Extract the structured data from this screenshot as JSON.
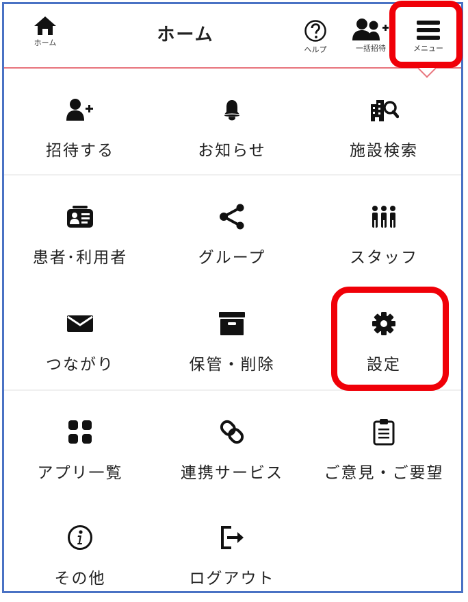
{
  "header": {
    "title": "ホーム",
    "home_label": "ホーム",
    "help_label": "ヘルプ",
    "bulk_invite_label": "一括招待",
    "menu_label": "メニュー"
  },
  "menu": {
    "invite": "招待する",
    "notifications": "お知らせ",
    "facility_search": "施設検索",
    "patients_users": "患者･利用者",
    "groups": "グループ",
    "staff": "スタッフ",
    "connections": "つながり",
    "archive_delete": "保管・削除",
    "settings": "設定",
    "app_list": "アプリ一覧",
    "integration_services": "連携サービス",
    "feedback_requests": "ご意見・ご要望",
    "other": "その他",
    "logout": "ログアウト"
  },
  "icons": {
    "home": "home-icon",
    "help": "help-circle-icon",
    "bulk_invite": "user-plus-group-icon",
    "menu": "hamburger-menu-icon",
    "invite": "user-plus-icon",
    "notifications": "bell-icon",
    "facility_search": "building-search-icon",
    "patients_users": "id-card-icon",
    "groups": "share-nodes-icon",
    "staff": "people-group-icon",
    "connections": "envelope-icon",
    "archive_delete": "archive-box-icon",
    "settings": "gear-icon",
    "app_list": "grid-icon",
    "integration_services": "link-icon",
    "feedback_requests": "clipboard-icon",
    "other": "info-circle-icon",
    "logout": "sign-out-icon"
  },
  "colors": {
    "highlight": "#f00008",
    "frame_border": "#4a72c4",
    "header_line": "#e8747c",
    "icon": "#222222"
  }
}
